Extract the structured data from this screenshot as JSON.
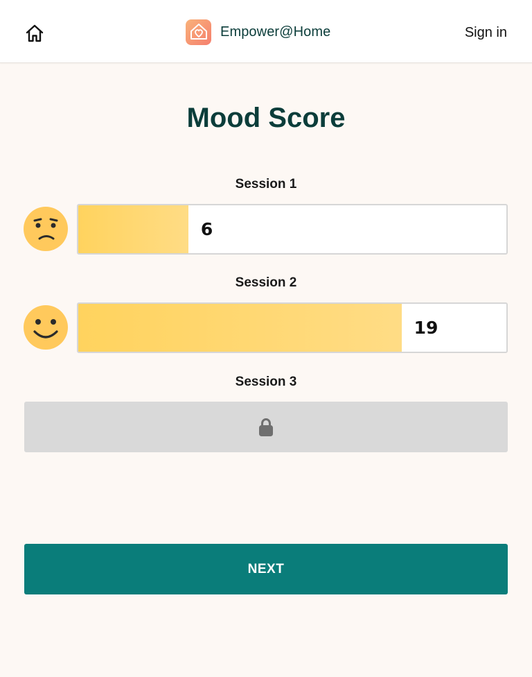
{
  "header": {
    "brand_name": "Empower@Home",
    "sign_in_label": "Sign in",
    "icons": {
      "home": "home-icon",
      "logo": "heart-house-logo"
    }
  },
  "page_title": "Mood Score",
  "sessions": [
    {
      "label": "Session 1",
      "score": "6",
      "mood": "worried-face",
      "fill_fraction": 0.257,
      "locked": false
    },
    {
      "label": "Session 2",
      "score": "19",
      "mood": "smiling-face",
      "fill_fraction": 0.755,
      "locked": false
    },
    {
      "label": "Session 3",
      "score": null,
      "mood": null,
      "fill_fraction": 0,
      "locked": true,
      "icon": "lock-icon"
    }
  ],
  "next_button_label": "NEXT",
  "colors": {
    "brand_teal": "#0b3d3a",
    "button_teal": "#0a7d7a",
    "bar_fill": "#ffd35e",
    "emoji_yellow": "#ffc95c",
    "locked_gray": "#d9d9d9",
    "background": "#fdf8f4"
  }
}
